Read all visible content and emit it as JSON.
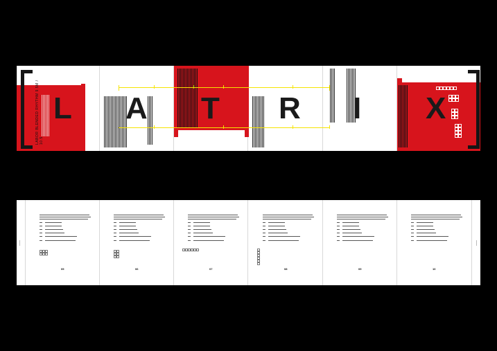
{
  "title_letters": [
    "L",
    "A",
    "T",
    "R",
    "I",
    "X"
  ],
  "cover_vertical_text": "LABOR BLENDED RHYTHM 9.5M / 10.5",
  "colors": {
    "red": "#d7141c",
    "yellow": "#f5e400",
    "black": "#151515",
    "background": "#000000"
  },
  "bottom_page_numbers": [
    "05",
    "06",
    "07",
    "08",
    "09",
    "10"
  ]
}
